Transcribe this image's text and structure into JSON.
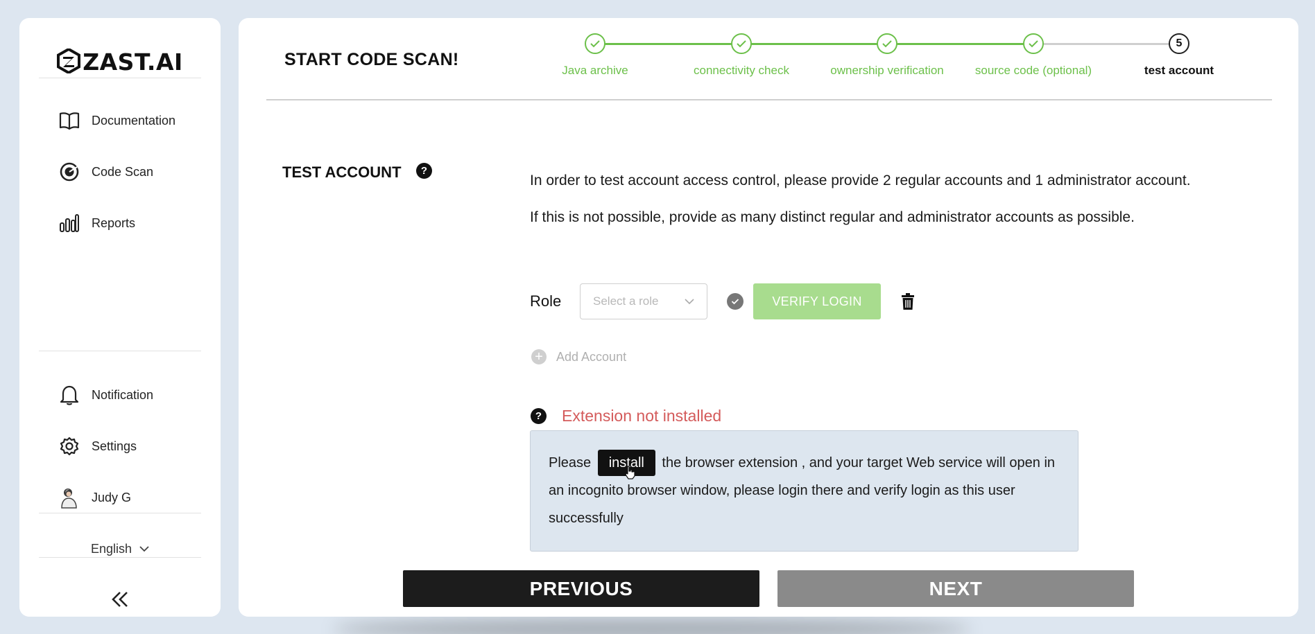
{
  "brand": {
    "name": "ZAST.AI"
  },
  "sidebar": {
    "nav": [
      {
        "label": "Documentation",
        "icon": "book-icon"
      },
      {
        "label": "Code Scan",
        "icon": "scan-target-icon"
      },
      {
        "label": "Reports",
        "icon": "bar-chart-icon"
      }
    ],
    "bottom": [
      {
        "label": "Notification",
        "icon": "bell-icon"
      },
      {
        "label": "Settings",
        "icon": "gear-icon"
      },
      {
        "label": "Judy G",
        "icon": "avatar"
      }
    ],
    "language": "English",
    "collapse_icon": "double-chevron-left-icon"
  },
  "header": {
    "title": "START CODE SCAN!",
    "steps": [
      {
        "label": "Java archive",
        "state": "done"
      },
      {
        "label": "connectivity check",
        "state": "done"
      },
      {
        "label": "ownership verification",
        "state": "done"
      },
      {
        "label": "source code (optional)",
        "state": "done"
      },
      {
        "label": "test account",
        "state": "current",
        "number": "5"
      }
    ]
  },
  "test_account": {
    "label": "TEST ACCOUNT",
    "description": "In order to test account access control, please provide 2 regular accounts and 1 administrator account. If this is not possible, provide as many distinct regular and administrator accounts as possible.",
    "role_label": "Role",
    "role_placeholder": "Select a role",
    "verify_label": "VERIFY LOGIN",
    "add_account_label": "Add Account",
    "extension_status": "Extension not installed",
    "info_prefix": "Please",
    "install_label": "install",
    "info_suffix": " the browser extension , and your target Web service will open in an incognito browser window, please login there and verify  login as this user successfully"
  },
  "footer": {
    "previous_label": "PREVIOUS",
    "next_label": "NEXT"
  },
  "colors": {
    "accent_green": "#6cc04a",
    "verify_green": "#a8dc8e",
    "error_red": "#d45b5b",
    "info_bg": "#dde6ef"
  }
}
